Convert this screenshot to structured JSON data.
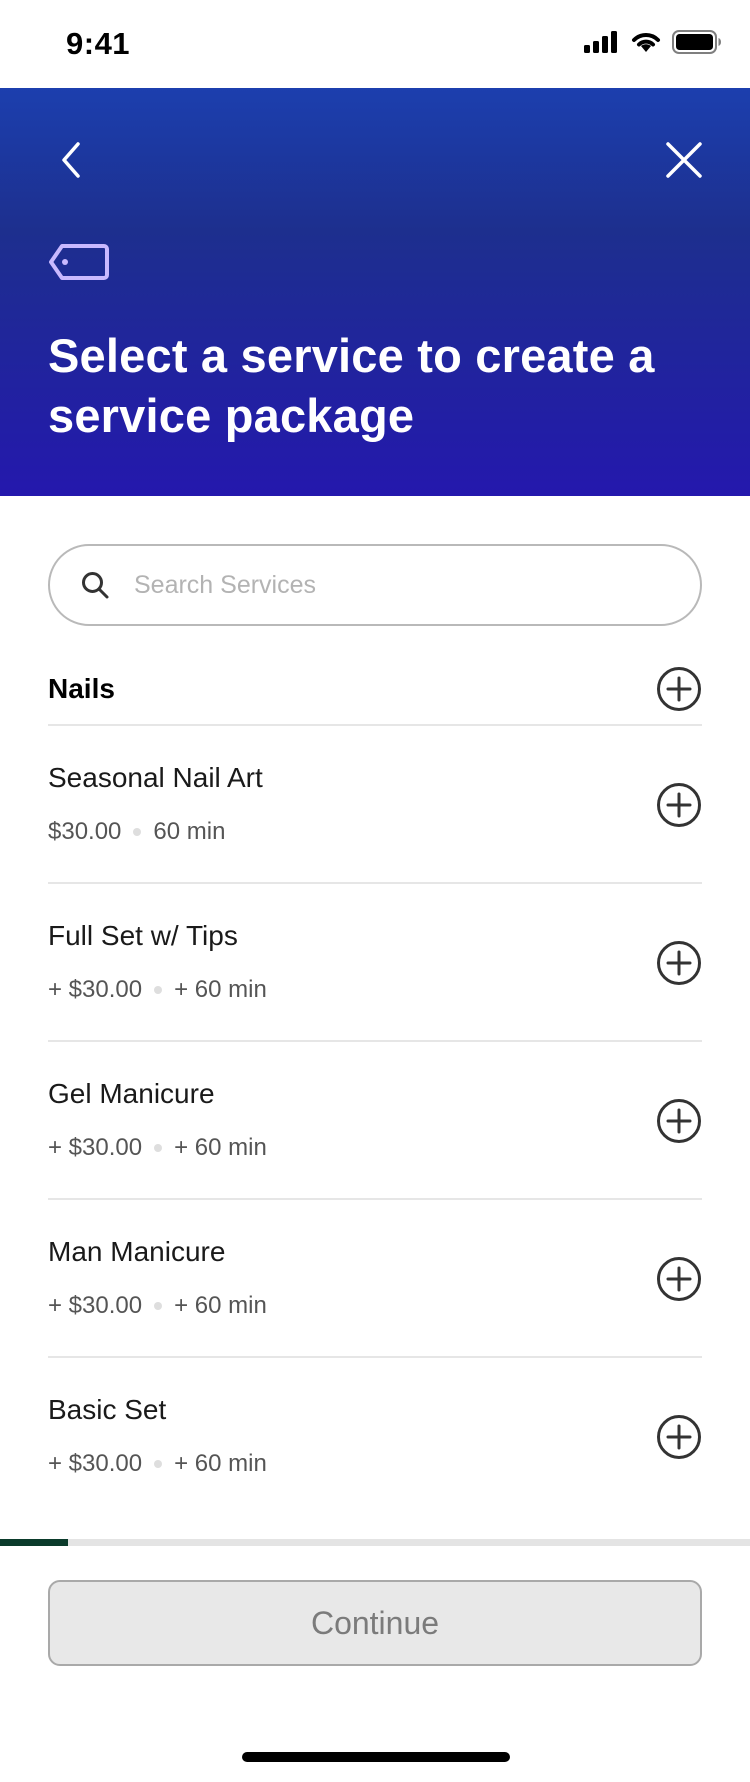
{
  "status_bar": {
    "time": "9:41"
  },
  "header": {
    "title": "Select a service to create a service package"
  },
  "search": {
    "placeholder": "Search Services",
    "value": ""
  },
  "category": {
    "title": "Nails"
  },
  "services": [
    {
      "name": "Seasonal Nail Art",
      "price": "$30.00",
      "duration": "60 min"
    },
    {
      "name": "Full Set w/ Tips",
      "price": "+ $30.00",
      "duration": "+ 60 min"
    },
    {
      "name": "Gel Manicure",
      "price": "+ $30.00",
      "duration": "+ 60 min"
    },
    {
      "name": "Man Manicure",
      "price": "+ $30.00",
      "duration": "+ 60 min"
    },
    {
      "name": "Basic Set",
      "price": "+ $30.00",
      "duration": "+ 60 min"
    }
  ],
  "progress": {
    "fraction": 0.09
  },
  "footer": {
    "continue_label": "Continue"
  },
  "colors": {
    "header_top": "#1c3fae",
    "header_bottom": "#2418ad",
    "progress_fill": "#0b3b2b",
    "button_disabled_bg": "#e8e8e8"
  }
}
